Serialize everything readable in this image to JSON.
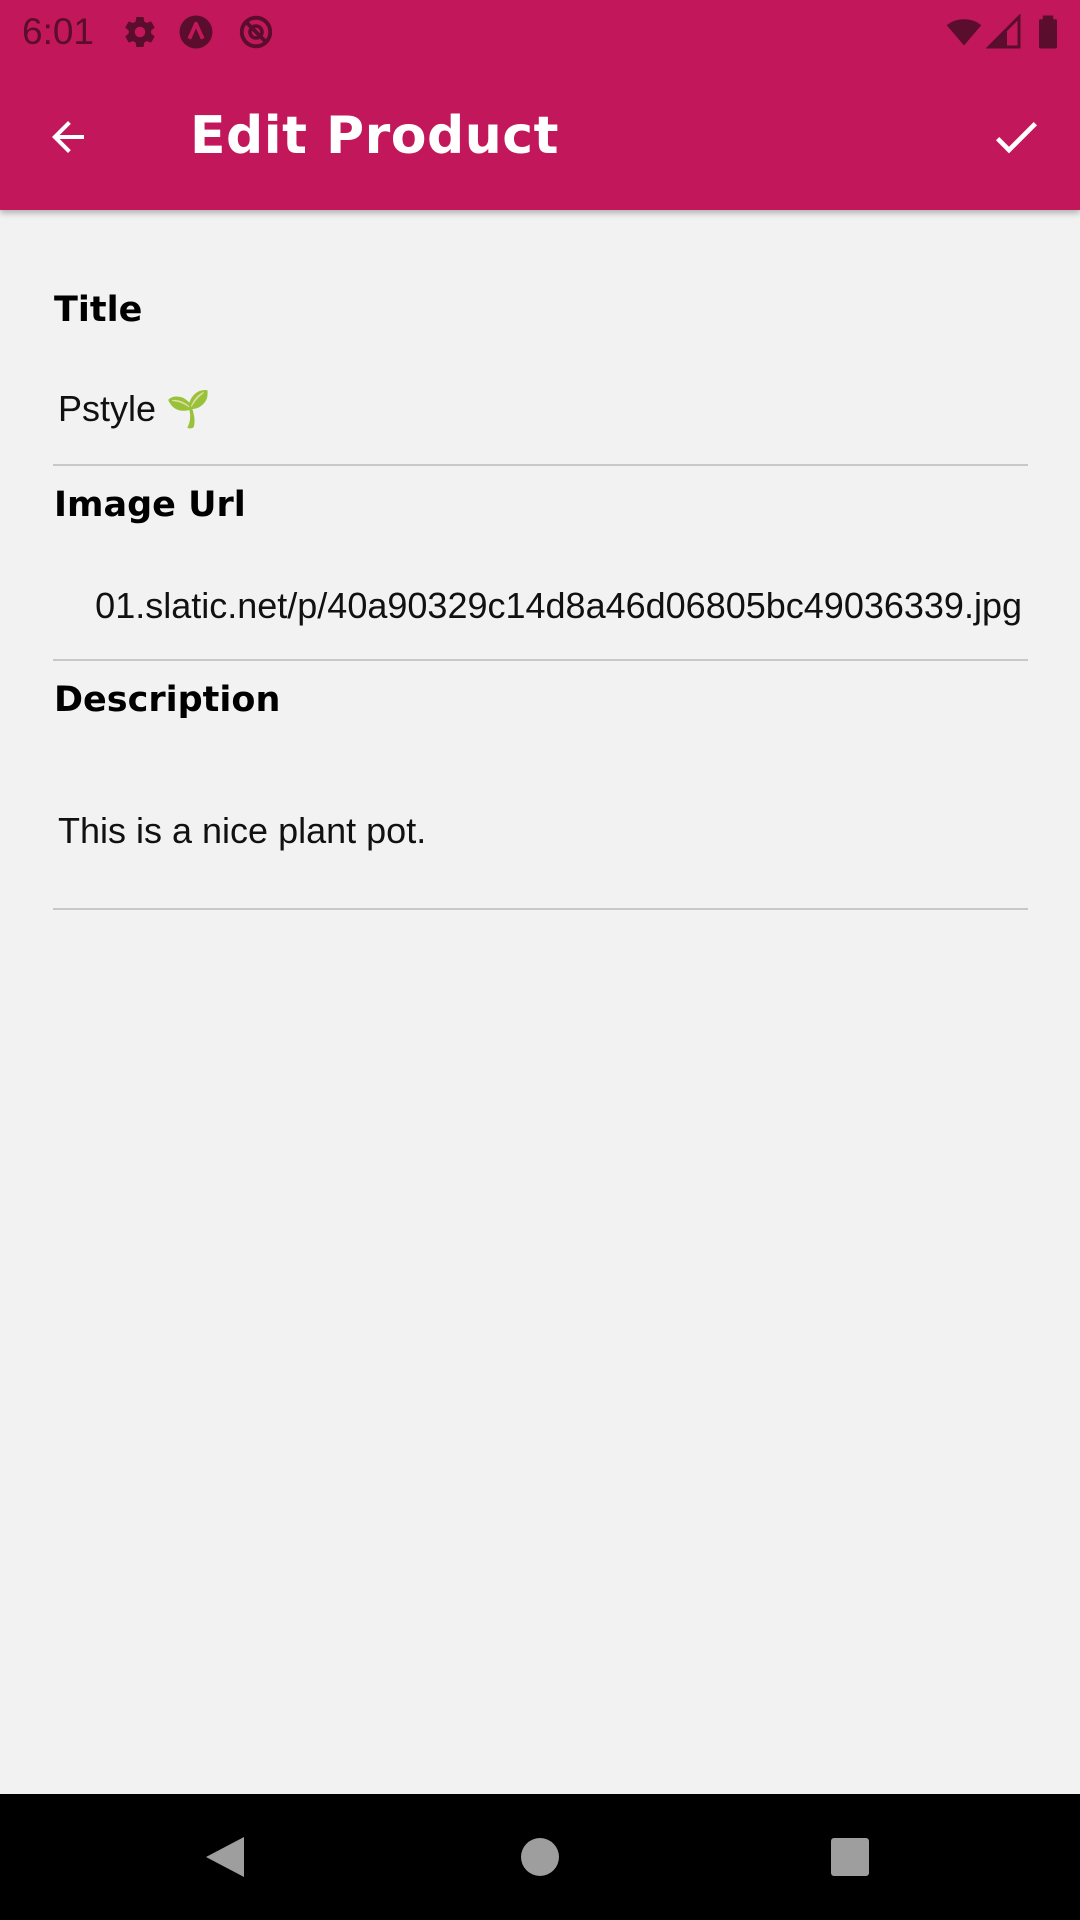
{
  "status_bar": {
    "time": "6:01",
    "left_icons": [
      "settings-icon",
      "app-notification-icon",
      "sync-disabled-icon"
    ],
    "right_icons": [
      "wifi-icon",
      "cellular-signal-icon",
      "battery-icon"
    ]
  },
  "toolbar": {
    "title": "Edit Product",
    "back_icon": "arrow-back-icon",
    "save_icon": "check-icon",
    "color": "#c2185b"
  },
  "form": {
    "title_label": "Title",
    "title_value": "Pstyle 🌱",
    "image_url_label": "Image Url",
    "image_url_value": "01.slatic.net/p/40a90329c14d8a46d06805bc49036339.jpg",
    "description_label": "Description",
    "description_value": "This is a nice plant pot."
  },
  "nav_bar": {
    "icons": [
      "back-triangle-icon",
      "home-circle-icon",
      "recents-square-icon"
    ]
  }
}
